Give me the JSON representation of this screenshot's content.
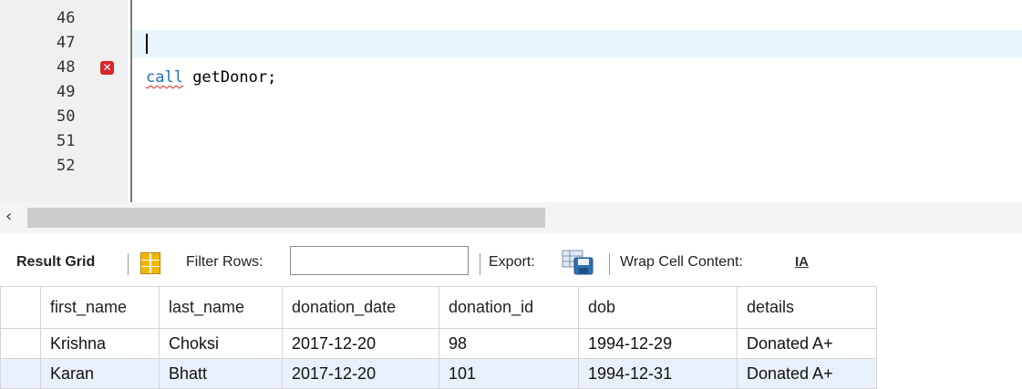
{
  "editor": {
    "line_numbers": [
      "46",
      "47",
      "48",
      "49",
      "50",
      "51",
      "52"
    ],
    "error_line": "48",
    "code_keyword": "call",
    "code_rest": " getDonor;"
  },
  "toolbar": {
    "result_grid_label": "Result Grid",
    "filter_rows_label": "Filter Rows:",
    "filter_value": "",
    "export_label": "Export:",
    "wrap_label": "Wrap Cell Content:",
    "wrap_icon_text": "IA"
  },
  "grid": {
    "columns": [
      "first_name",
      "last_name",
      "donation_date",
      "donation_id",
      "dob",
      "details"
    ],
    "rows": [
      [
        "Krishna",
        "Choksi",
        "2017-12-20",
        "98",
        "1994-12-29",
        "Donated A+"
      ],
      [
        "Karan",
        "Bhatt",
        "2017-12-20",
        "101",
        "1994-12-31",
        "Donated A+"
      ]
    ]
  },
  "colors": {
    "keyword": "#1f6fbf",
    "error": "#d9262b",
    "current_line": "#e8f6fb",
    "selected_row": "#e8f1fb"
  }
}
